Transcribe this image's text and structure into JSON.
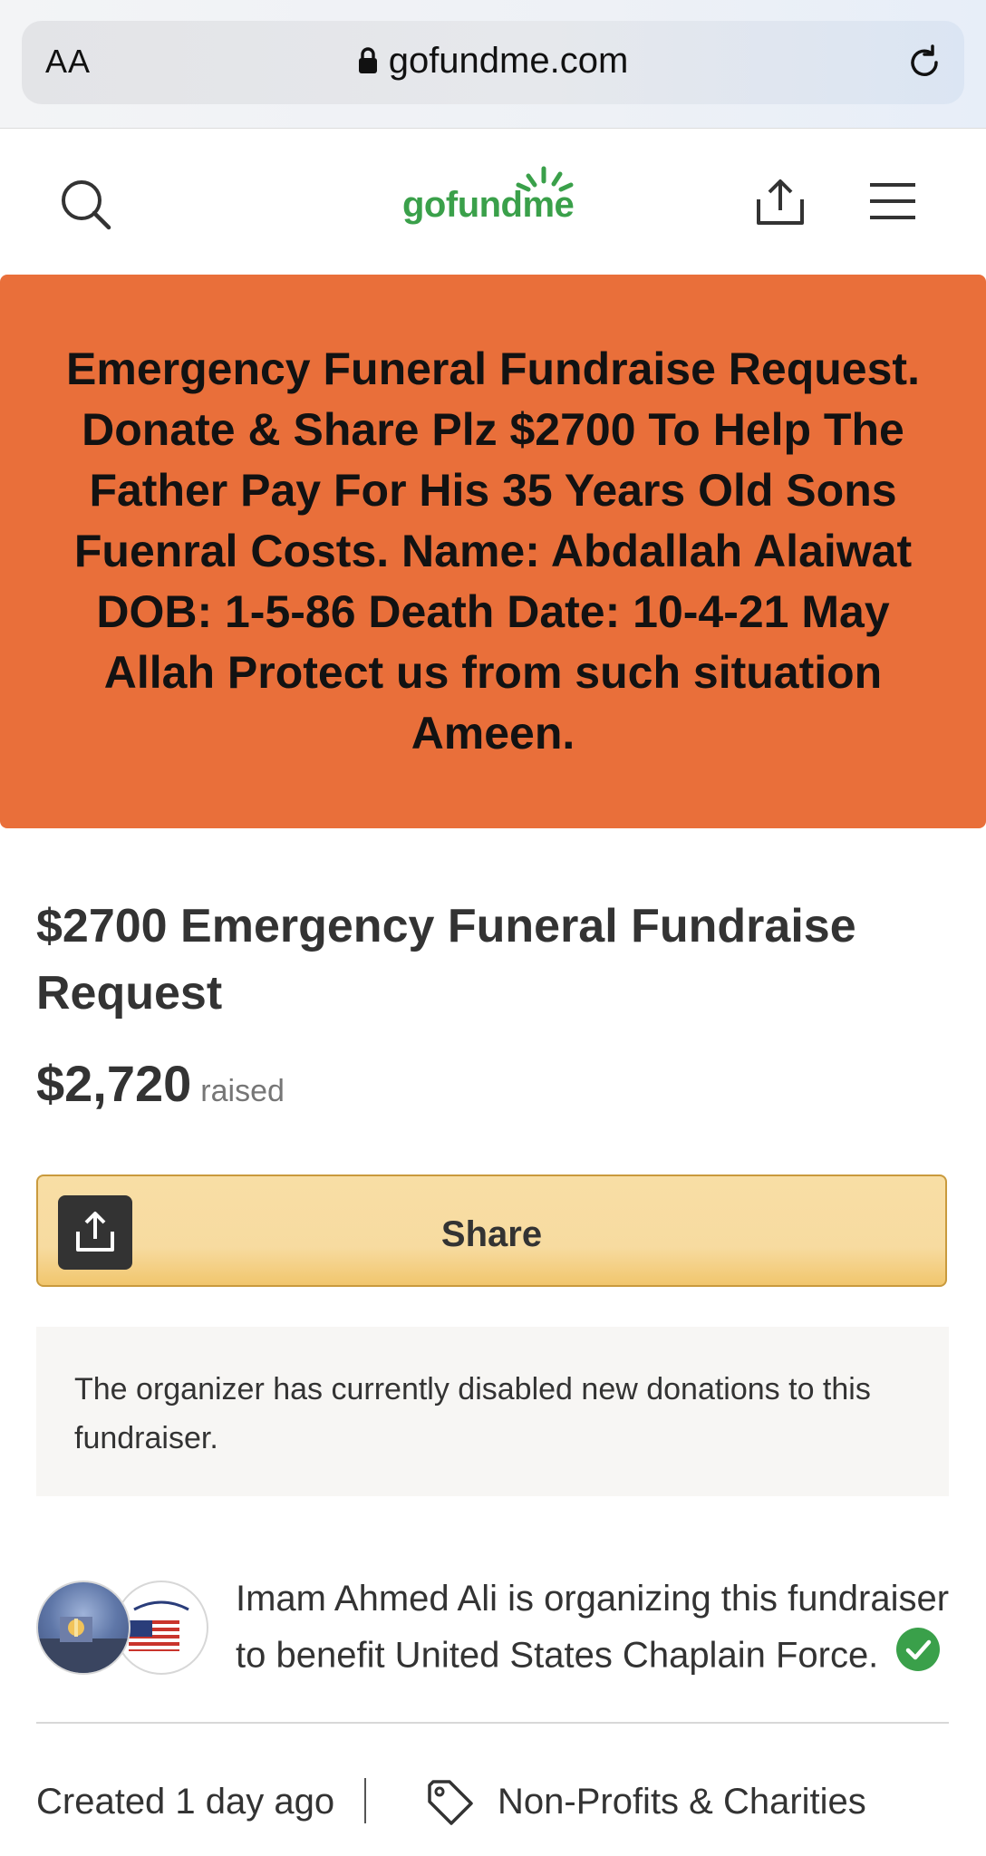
{
  "browser": {
    "text_size_label": "AA",
    "url": "gofundme.com"
  },
  "header": {
    "logo_text": "gofundme"
  },
  "hero": {
    "text": "Emergency Funeral Fundraise Request. Donate & Share Plz $2700 To Help The Father Pay For His 35 Years Old Sons Fuenral Costs. Name: Abdallah Alaiwat DOB: 1-5-86 Death Date: 10-4-21 May Allah Protect us from such situation Ameen."
  },
  "campaign": {
    "title": "$2700 Emergency Funeral Fundraise Request",
    "amount_raised": "$2,720",
    "raised_label": "raised",
    "share_label": "Share",
    "notice": "The organizer has currently disabled new donations to this fundraiser.",
    "organizer_text": "Imam Ahmed Ali is organizing this fundraiser to benefit United States Chaplain Force.",
    "created": "Created 1 day ago",
    "category": "Non-Profits & Charities"
  },
  "colors": {
    "brand_green": "#3aa04a",
    "hero_orange": "#e96f3a",
    "share_yellow": "#f7dba0",
    "verified_green": "#3aa04a"
  },
  "icons": [
    "lock-icon",
    "reload-icon",
    "search-icon",
    "share-icon",
    "menu-icon",
    "verified-icon",
    "tag-icon"
  ]
}
